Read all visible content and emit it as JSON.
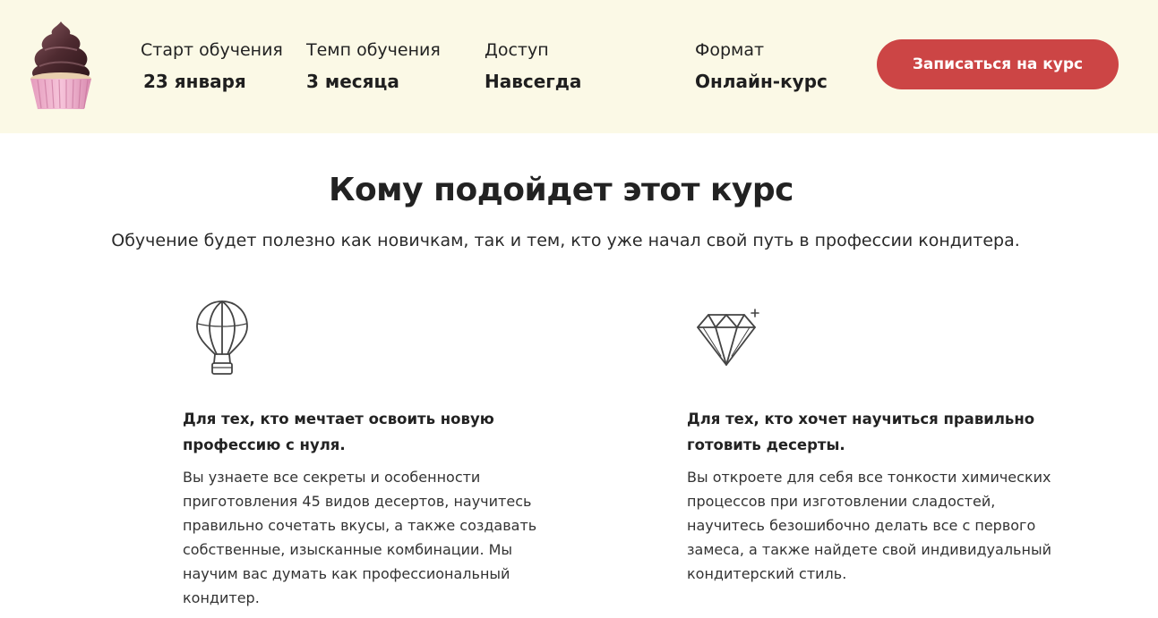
{
  "header": {
    "items": [
      {
        "label": "Старт обучения",
        "value": "23 января"
      },
      {
        "label": "Темп обучения",
        "value": "3 месяца"
      },
      {
        "label": "Доступ",
        "value": "Навсегда"
      },
      {
        "label": "Формат",
        "value": "Онлайн-курс"
      }
    ],
    "cta_label": "Записаться на курс",
    "cta_color": "#cc4545",
    "bg_color": "#fbf9e6",
    "logo_icon": "cupcake-icon"
  },
  "section": {
    "title": "Кому подойдет этот курс",
    "subtitle": "Обучение будет полезно как новичкам, так и тем, кто уже начал свой путь в профессии кондитера."
  },
  "features": [
    {
      "icon": "hot-air-balloon-icon",
      "title": "Для тех, кто мечтает освоить новую профессию с нуля.",
      "text": "Вы узнаете все секреты и особенности приготовления 45 видов десертов, научитесь правильно сочетать вкусы, а также создавать собственные, изысканные комбинации. Мы научим вас думать как профессиональный кондитер."
    },
    {
      "icon": "diamond-icon",
      "title": "Для тех, кто хочет научиться правильно готовить десерты.",
      "text": "Вы откроете для себя все тонкости химических процессов при изготовлении сладостей, научитесь безошибочно делать все с первого замеса, а также найдете свой индивидуальный кондитерский стиль."
    }
  ]
}
